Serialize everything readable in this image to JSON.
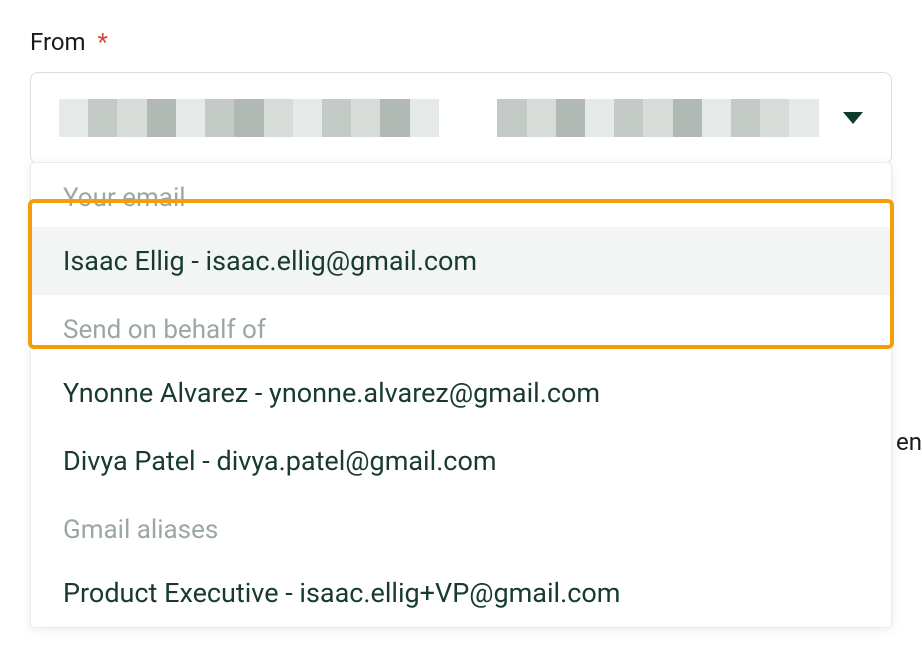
{
  "field": {
    "label": "From",
    "required_mark": "*"
  },
  "dropdown": {
    "groups": [
      {
        "key": "your_email",
        "header": "Your email",
        "options": [
          {
            "key": "isaac",
            "label": "Isaac Ellig - isaac.ellig@gmail.com",
            "selected": true
          }
        ]
      },
      {
        "key": "send_on_behalf",
        "header": "Send on behalf of",
        "options": [
          {
            "key": "ynonne",
            "label": "Ynonne Alvarez - ynonne.alvarez@gmail.com",
            "selected": false
          },
          {
            "key": "divya",
            "label": "Divya Patel - divya.patel@gmail.com",
            "selected": false
          }
        ]
      },
      {
        "key": "gmail_aliases",
        "header": "Gmail aliases",
        "options": [
          {
            "key": "product_exec",
            "label": "Product Executive - isaac.ellig+VP@gmail.com",
            "selected": false
          }
        ]
      }
    ]
  },
  "edge_text": "en",
  "pixelation_colors": [
    "#e5e9e7",
    "#c4cbc7",
    "#d7dcd9",
    "#b0b9b3",
    "#e5e9e7",
    "#c4cbc7",
    "#b0b9b3",
    "#d7dcd9",
    "#e5e9e7",
    "#c4cbc7",
    "#d7dcd9",
    "#b0b9b3",
    "#e5e9e7",
    "#ffffff",
    "#ffffff",
    "#c4cbc7",
    "#d7dcd9",
    "#b0b9b3",
    "#e5e9e7",
    "#c4cbc7",
    "#d7dcd9",
    "#b0b9b3",
    "#e5e9e7",
    "#c4cbc7",
    "#d7dcd9",
    "#e5e9e7"
  ]
}
